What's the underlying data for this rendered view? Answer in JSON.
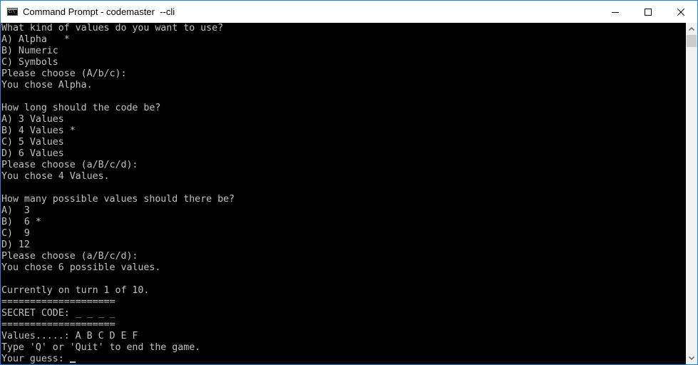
{
  "window": {
    "title": "Command Prompt - codemaster  --cli",
    "icon": "cmd-icon",
    "icon_text": "C:\\_",
    "controls": {
      "minimize": "minimize-icon",
      "maximize": "maximize-icon",
      "close": "close-icon"
    },
    "accent_color": "#1883d7"
  },
  "console": {
    "text_color": "#c0c0c0",
    "background": "#000000",
    "lines": [
      "What kind of values do you want to use?",
      "A) Alpha   *",
      "B) Numeric",
      "C) Symbols",
      "Please choose (A/b/c):",
      "You chose Alpha.",
      "",
      "How long should the code be?",
      "A) 3 Values",
      "B) 4 Values *",
      "C) 5 Values",
      "D) 6 Values",
      "Please choose (a/B/c/d):",
      "You chose 4 Values.",
      "",
      "How many possible values should there be?",
      "A)  3",
      "B)  6 *",
      "C)  9",
      "D) 12",
      "Please choose (a/B/c/d):",
      "You chose 6 possible values.",
      "",
      "Currently on turn 1 of 10.",
      "====================",
      "SECRET CODE: _ _ _ _",
      "====================",
      "Values.....: A B C D E F",
      "Type 'Q' or 'Quit' to end the game.",
      "Your guess: "
    ]
  },
  "scrollbar": {
    "up_icon": "chevron-up-icon",
    "down_icon": "chevron-down-icon"
  }
}
